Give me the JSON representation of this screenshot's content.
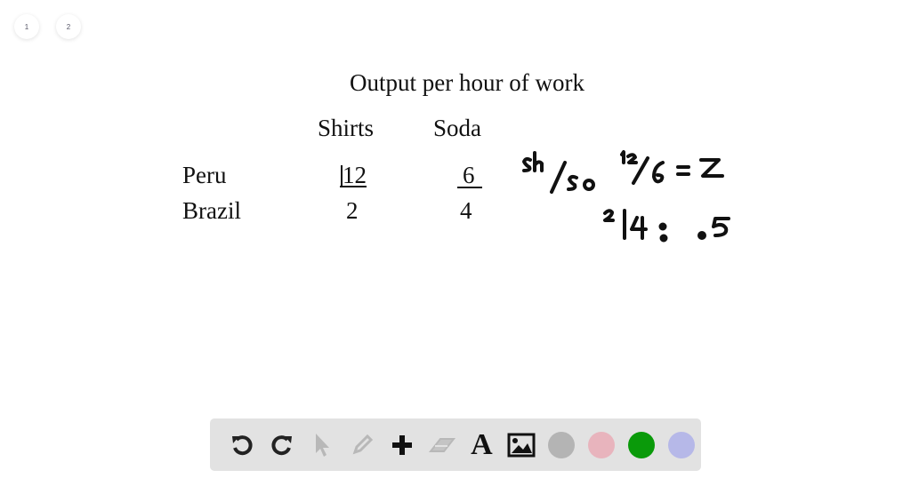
{
  "pages": [
    {
      "label": "1"
    },
    {
      "label": "2"
    }
  ],
  "table": {
    "title": "Output per hour of work",
    "columns": [
      "Shirts",
      "Soda"
    ],
    "rows": [
      {
        "country": "Peru",
        "shirts": "12",
        "soda": "6"
      },
      {
        "country": "Brazil",
        "shirts": "2",
        "soda": "4"
      }
    ]
  },
  "annotations": {
    "ratio_label": "sh/so",
    "peru_calc": "12/6 = 2",
    "brazil_calc": "2/4 = .5"
  },
  "toolbar": {
    "tools": [
      "undo",
      "redo",
      "select",
      "pencil",
      "add",
      "eraser",
      "text",
      "image"
    ],
    "text_tool_glyph": "A",
    "colors": [
      "#b4b4b4",
      "#e8b4bd",
      "#0a9a0a",
      "#b6b8e8"
    ]
  }
}
